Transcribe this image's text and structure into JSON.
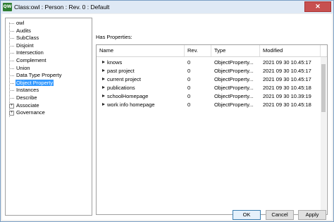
{
  "window": {
    "title": "Class:owl : Person : Rev. 0 : Default",
    "app_icon_text": "QW",
    "close_label": "✕"
  },
  "tree": {
    "items": [
      {
        "label": "owl",
        "selected": false,
        "expandable": false
      },
      {
        "label": "Audits",
        "selected": false,
        "expandable": false
      },
      {
        "label": "SubClass",
        "selected": false,
        "expandable": false
      },
      {
        "label": "Disjoint",
        "selected": false,
        "expandable": false
      },
      {
        "label": "Intersection",
        "selected": false,
        "expandable": false
      },
      {
        "label": "Complement",
        "selected": false,
        "expandable": false
      },
      {
        "label": "Union",
        "selected": false,
        "expandable": false
      },
      {
        "label": "Data Type Property",
        "selected": false,
        "expandable": false
      },
      {
        "label": "Object Property",
        "selected": true,
        "expandable": false
      },
      {
        "label": "Instances",
        "selected": false,
        "expandable": false
      },
      {
        "label": "Describe",
        "selected": false,
        "expandable": false
      },
      {
        "label": "Associate",
        "selected": false,
        "expandable": true
      },
      {
        "label": "Governance",
        "selected": false,
        "expandable": true
      }
    ]
  },
  "properties": {
    "section_label": "Has Properties:",
    "columns": [
      "Name",
      "Rev.",
      "Type",
      "Modified"
    ],
    "rows": [
      {
        "name": "knows",
        "rev": "0",
        "type": "ObjectProperty...",
        "modified": "2021 09 30 10.45:17"
      },
      {
        "name": "past project",
        "rev": "0",
        "type": "ObjectProperty...",
        "modified": "2021 09 30 10.45:17"
      },
      {
        "name": "current project",
        "rev": "0",
        "type": "ObjectProperty...",
        "modified": "2021 09 30 10.45:17"
      },
      {
        "name": "publications",
        "rev": "0",
        "type": "ObjectProperty...",
        "modified": "2021 09 30 10.45:18"
      },
      {
        "name": "schoolHomepage",
        "rev": "0",
        "type": "ObjectProperty...",
        "modified": "2021 09 30 10.39:19"
      },
      {
        "name": "work info homepage",
        "rev": "0",
        "type": "ObjectProperty...",
        "modified": "2021 09 30 10.45:18"
      }
    ]
  },
  "buttons": {
    "ok": "OK",
    "cancel": "Cancel",
    "apply": "Apply"
  }
}
